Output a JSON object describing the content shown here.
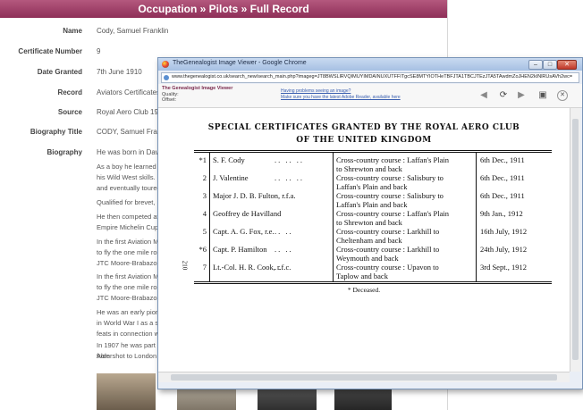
{
  "page": {
    "header": "Occupation » Pilots » Full Record",
    "record": [
      {
        "label": "Name",
        "value": "Cody, Samuel Franklin"
      },
      {
        "label": "Certificate Number",
        "value": "9"
      },
      {
        "label": "Date Granted",
        "value": "7th June 1910"
      },
      {
        "label": "Record",
        "value": "Aviators Certificates"
      },
      {
        "label": "Source",
        "value": "Royal Aero Club 1924"
      },
      {
        "label": "Biography Title",
        "value": "CODY, Samuel Franklin"
      },
      {
        "label": "Biography",
        "value": "He was born in Daven"
      }
    ],
    "bio_paragraphs": [
      "As a boy he learned th",
      "his Wild West skills. H",
      "and eventually toured t",
      "Qualified for brevet, No",
      "He then competed at W",
      "Empire Michelin Cups",
      "In the first Aviation Me",
      "to fly the one mile rout",
      "JTC Moore-Brabazon a",
      "In the first Aviation Me",
      "to fly the one mile rout",
      "JTC Moore-Brabazon a",
      "He was an early pione",
      "in World War I as a sm",
      "feats in connection wit",
      "In 1907 he was part of a team based at Aldershot building the first British powered airship Nulli Secondus which flew from",
      "Aldershot to London in 3 hours 25 minutes."
    ]
  },
  "viewer": {
    "title": "TheGenealogist Image Viewer - Google Chrome",
    "url": "www.thegenealogist.co.uk/search_new/search_main.php?imageg=JT8BWSLlRVQIMUYIMDAINUXUTFFITgcSE8MTYIOTHeTBFJTA1TBCJTEzJTA5TAwdmZoJHEN2kINlRUsAVh2wc=",
    "brand_top": "The Genealogist Image Viewer",
    "quality_label": "Quality:",
    "offset_label": "Offset:",
    "link1": "Having problems seeing an image?",
    "link2": "Make sure you have the latest Adobe Reader, available here",
    "buttons": {
      "min": "–",
      "max": "□",
      "close": "✕"
    },
    "icons": [
      "back-arrow-icon",
      "forward-arrow-icon",
      "rotate-icon",
      "save-icon",
      "close-icon"
    ]
  },
  "document": {
    "title_line1": "SPECIAL CERTIFICATES GRANTED BY THE ROYAL AERO CLUB",
    "title_line2": "OF THE UNITED KINGDOM",
    "page_side_number": "210",
    "rows": [
      {
        "num": "*1",
        "name": "S. F. Cody",
        "dots": ".. .. ..",
        "route1": "Cross-country course : Laffan's Plain",
        "route2": "to Shrewton and back",
        "date": "6th Dec., 1911"
      },
      {
        "num": "2",
        "name": "J. Valentine",
        "dots": ".. .. ..",
        "route1": "Cross-country course : Salisbury to",
        "route2": "Laffan's Plain and back",
        "date": "6th Dec., 1911"
      },
      {
        "num": "3",
        "name": "Major J. D. B. Fulton, r.f.a.",
        "dots": "",
        "route1": "Cross-country course : Salisbury to",
        "route2": "Laffan's Plain and back",
        "date": "6th Dec., 1911"
      },
      {
        "num": "4",
        "name": "Geoffrey de Havilland",
        "dots": "",
        "route1": "Cross-country course : Laffan's Plain",
        "route2": "to Shrewton and back",
        "date": "9th Jan., 1912"
      },
      {
        "num": "5",
        "name": "Capt. A. G. Fox, r.e.",
        "dots": ".. ..",
        "route1": "Cross-country course : Larkhill to",
        "route2": "Cheltenham and back",
        "date": "16th July, 1912"
      },
      {
        "num": "*6",
        "name": "Capt. P. Hamilton",
        "dots": ".. ..",
        "route1": "Cross-country course : Larkhill to",
        "route2": "Weymouth and back",
        "date": "24th July, 1912"
      },
      {
        "num": "7",
        "name": "Lt.-Col. H. R. Cook, r.f.c.",
        "dots": "..",
        "route1": "Cross-country course : Upavon to",
        "route2": "Taplow and back",
        "date": "3rd Sept., 1912"
      }
    ],
    "footnote": "* Deceased."
  }
}
